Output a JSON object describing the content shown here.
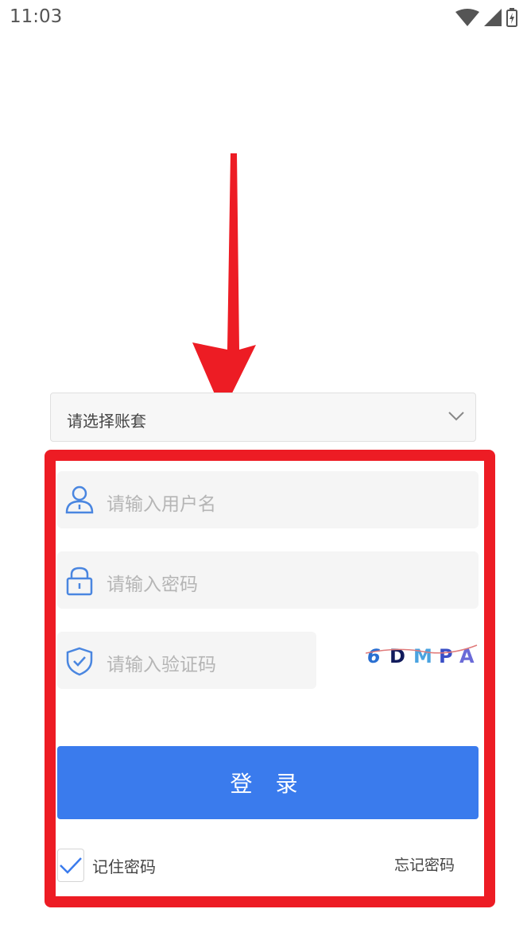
{
  "status": {
    "time": "11:03"
  },
  "account_select": {
    "placeholder": "请选择账套"
  },
  "fields": {
    "username_placeholder": "请输入用户名",
    "password_placeholder": "请输入密码",
    "captcha_placeholder": "请输入验证码"
  },
  "captcha": {
    "text": "6DMPA",
    "colors": [
      "#2a6fd1",
      "#111b5c",
      "#4aa3e0",
      "#3a4fc6",
      "#6a6ad8"
    ]
  },
  "login_button": {
    "label": "登 录"
  },
  "remember": {
    "label": "记住密码",
    "checked": true
  },
  "forgot": {
    "label": "忘记密码"
  },
  "colors": {
    "accent": "#3a7bed",
    "highlight": "#ed1c24",
    "icon": "#4a86e0"
  }
}
